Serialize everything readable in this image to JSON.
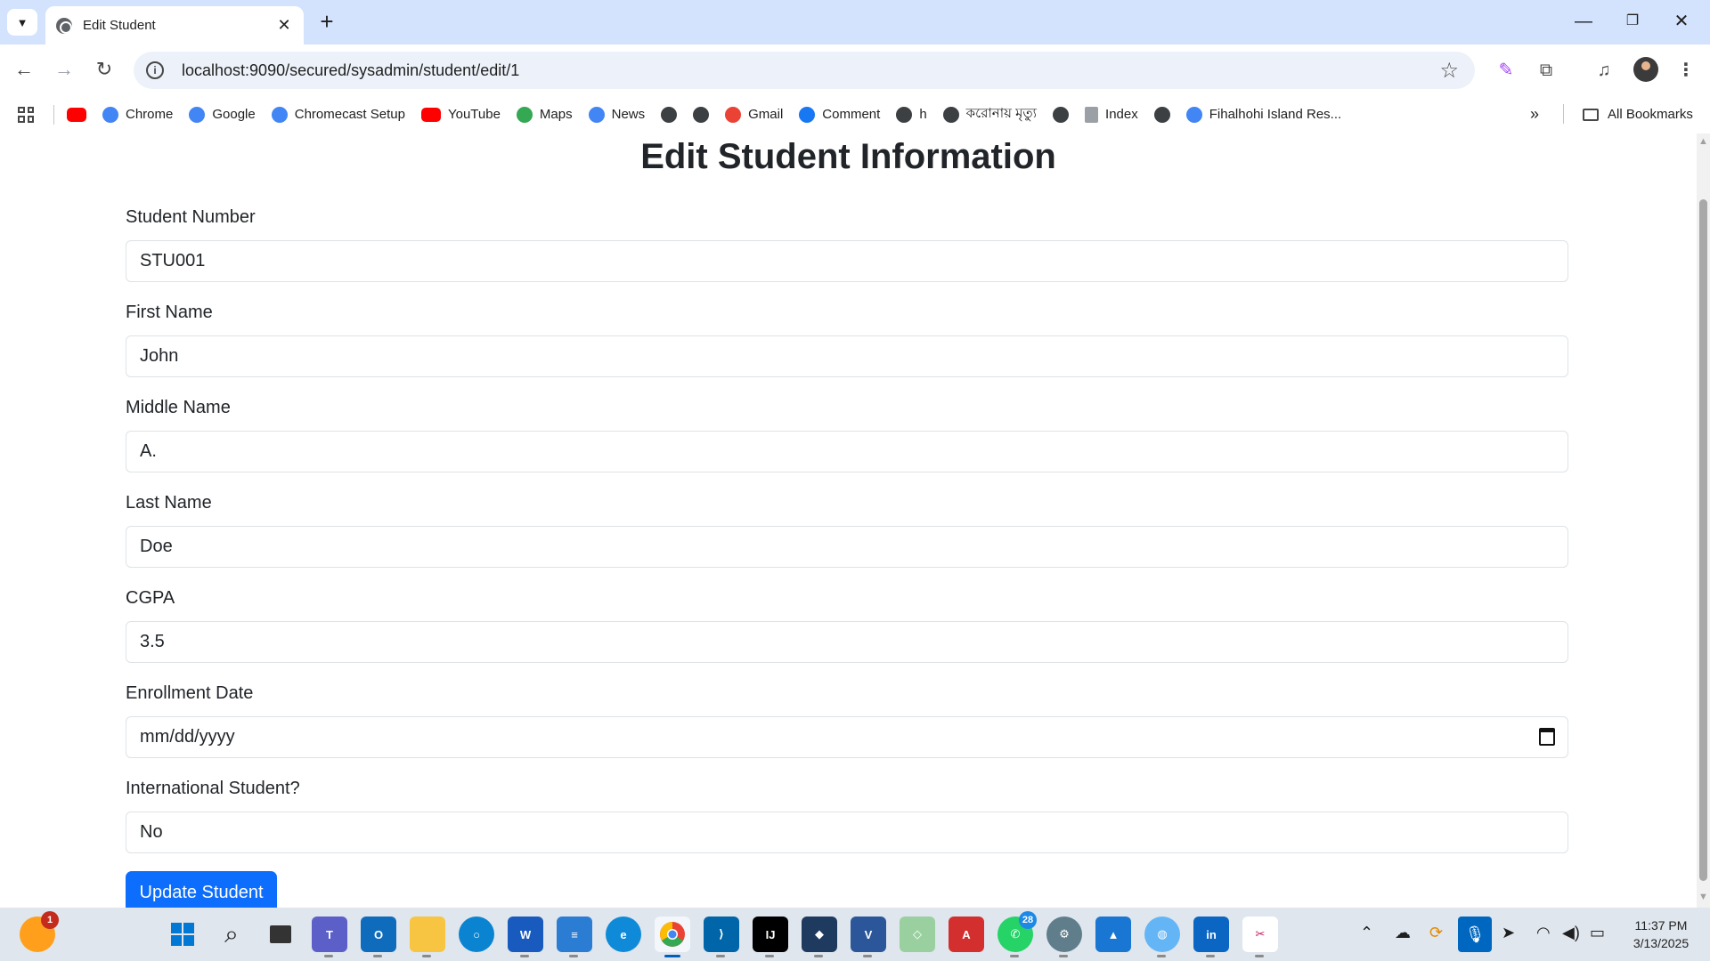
{
  "browser": {
    "tab_title": "Edit Student",
    "url": "localhost:9090/secured/sysadmin/student/edit/1",
    "bookmarks": [
      {
        "label": "",
        "icon": "youtube-icon",
        "color": "#ff0000"
      },
      {
        "label": "Chrome",
        "icon": "chrome-icon",
        "color": "#4285f4"
      },
      {
        "label": "Google",
        "icon": "google-icon",
        "color": "#4285f4"
      },
      {
        "label": "Chromecast Setup",
        "icon": "google-icon",
        "color": "#4285f4"
      },
      {
        "label": "YouTube",
        "icon": "youtube-icon",
        "color": "#ff0000"
      },
      {
        "label": "Maps",
        "icon": "maps-icon",
        "color": "#34a853"
      },
      {
        "label": "News",
        "icon": "news-icon",
        "color": "#4285f4"
      },
      {
        "label": "",
        "icon": "globe-icon",
        "color": "#3c4043"
      },
      {
        "label": "",
        "icon": "globe-icon",
        "color": "#3c4043"
      },
      {
        "label": "Gmail",
        "icon": "gmail-icon",
        "color": "#ea4335"
      },
      {
        "label": "Comment",
        "icon": "facebook-icon",
        "color": "#1877f2"
      },
      {
        "label": "h",
        "icon": "globe-icon",
        "color": "#3c4043"
      },
      {
        "label": "করোনায় মৃত্যু",
        "icon": "globe-icon",
        "color": "#3c4043"
      },
      {
        "label": "",
        "icon": "globe-icon",
        "color": "#3c4043"
      },
      {
        "label": "Index",
        "icon": "page-icon",
        "color": "#9aa0a6"
      },
      {
        "label": "",
        "icon": "globe-icon",
        "color": "#3c4043"
      },
      {
        "label": "Fihalhohi Island Res...",
        "icon": "google-icon",
        "color": "#4285f4"
      }
    ],
    "all_bookmarks_label": "All Bookmarks"
  },
  "form": {
    "title": "Edit Student Information",
    "fields": {
      "student_number": {
        "label": "Student Number",
        "value": "STU001"
      },
      "first_name": {
        "label": "First Name",
        "value": "John"
      },
      "middle_name": {
        "label": "Middle Name",
        "value": "A."
      },
      "last_name": {
        "label": "Last Name",
        "value": "Doe"
      },
      "cgpa": {
        "label": "CGPA",
        "value": "3.5"
      },
      "enrollment_date": {
        "label": "Enrollment Date",
        "placeholder": "mm/dd/yyyy"
      },
      "international": {
        "label": "International Student?",
        "value": "No"
      }
    },
    "submit_label": "Update Student"
  },
  "taskbar": {
    "tray_badge_count": "1",
    "whatsapp_badge": "28",
    "time": "11:37 PM",
    "date": "3/13/2025"
  },
  "colors": {
    "primary_button": "#0d6efd",
    "tab_strip": "#d3e3fd",
    "omnibox": "#edf2fa"
  }
}
